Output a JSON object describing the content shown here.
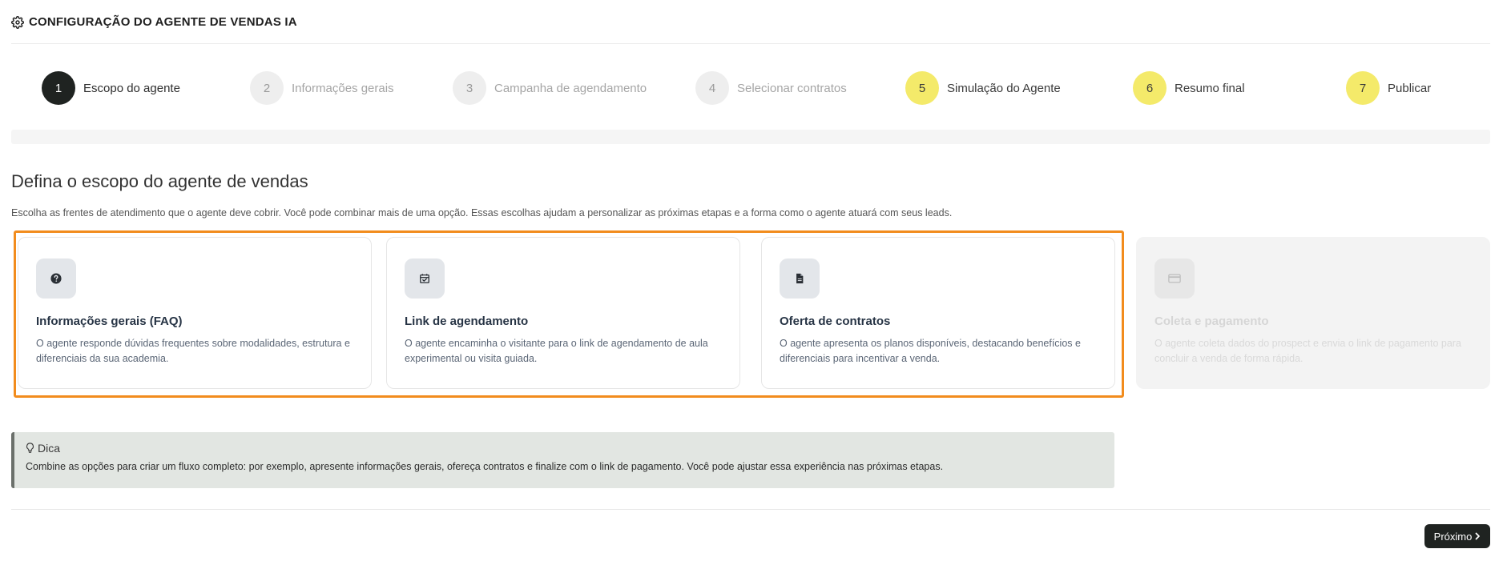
{
  "header": {
    "title": "CONFIGURAÇÃO DO AGENTE DE VENDAS IA",
    "icon": "gear-icon"
  },
  "steps": [
    {
      "number": "1",
      "label": "Escopo do agente",
      "state": "active"
    },
    {
      "number": "2",
      "label": "Informações gerais",
      "state": "disabled"
    },
    {
      "number": "3",
      "label": "Campanha de agendamento",
      "state": "disabled"
    },
    {
      "number": "4",
      "label": "Selecionar contratos",
      "state": "disabled"
    },
    {
      "number": "5",
      "label": "Simulação do Agente",
      "state": "pending"
    },
    {
      "number": "6",
      "label": "Resumo final",
      "state": "pending"
    },
    {
      "number": "7",
      "label": "Publicar",
      "state": "pending"
    }
  ],
  "main": {
    "title": "Defina o escopo do agente de vendas",
    "description": "Escolha as frentes de atendimento que o agente deve cobrir. Você pode combinar mais de uma opção. Essas escolhas ajudam a personalizar as próximas etapas e a forma como o agente atuará com seus leads."
  },
  "cards": [
    {
      "icon": "question-circle-icon",
      "title": "Informações gerais (FAQ)",
      "description": "O agente responde dúvidas frequentes sobre modalidades, estrutura e diferenciais da sua academia.",
      "enabled": true
    },
    {
      "icon": "calendar-check-icon",
      "title": "Link de agendamento",
      "description": "O agente encaminha o visitante para o link de agendamento de aula experimental ou visita guiada.",
      "enabled": true
    },
    {
      "icon": "document-icon",
      "title": "Oferta de contratos",
      "description": "O agente apresenta os planos disponíveis, destacando benefícios e diferenciais para incentivar a venda.",
      "enabled": true
    },
    {
      "icon": "credit-card-icon",
      "title": "Coleta e pagamento",
      "description": "O agente coleta dados do prospect e envia o link de pagamento para concluir a venda de forma rápida.",
      "enabled": false
    }
  ],
  "tip": {
    "icon": "lightbulb-icon",
    "title": "Dica",
    "text": "Combine as opções para criar um fluxo completo: por exemplo, apresente informações gerais, ofereça contratos e finalize com o link de pagamento. Você pode ajustar essa experiência nas próximas etapas."
  },
  "footer": {
    "next_label": "Próximo",
    "next_icon": "chevron-right-icon"
  },
  "colors": {
    "active_step": "#1f2321",
    "pending_step": "#f4ea6a",
    "highlight": "#f28c1d",
    "tip_background": "#e2e6e2"
  }
}
